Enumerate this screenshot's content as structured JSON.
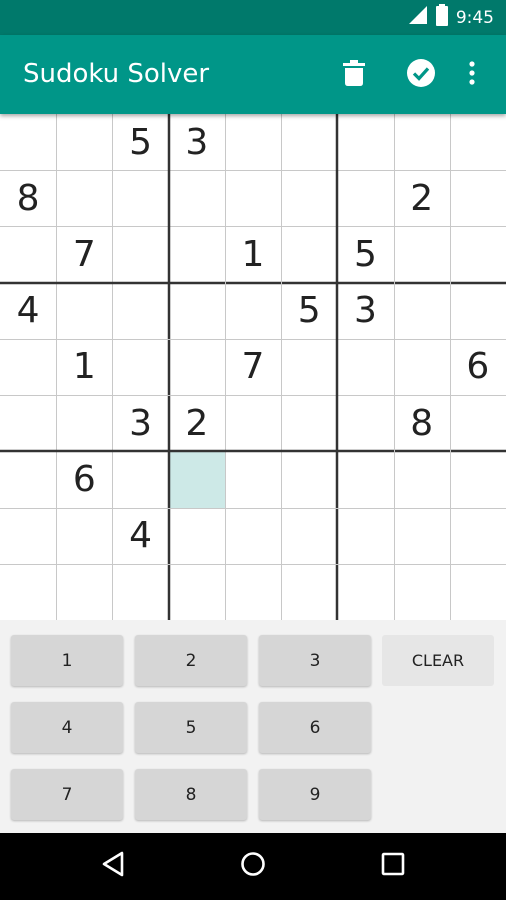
{
  "status_bar": {
    "time": "9:45",
    "icons": [
      "signal-icon",
      "battery-icon"
    ]
  },
  "app_bar": {
    "title": "Sudoku Solver",
    "actions": [
      "delete-icon",
      "check-circle-icon",
      "more-vert-icon"
    ]
  },
  "board": {
    "selected": [
      6,
      3
    ],
    "colors": {
      "selected": "#cde9e7",
      "grid_thin": "#c8c8c8",
      "grid_thick": "#333333"
    },
    "rows": [
      [
        "",
        "",
        "5",
        "3",
        "",
        "",
        "",
        "",
        ""
      ],
      [
        "8",
        "",
        "",
        "",
        "",
        "",
        "",
        "2",
        ""
      ],
      [
        "",
        "7",
        "",
        "",
        "1",
        "",
        "5",
        "",
        ""
      ],
      [
        "4",
        "",
        "",
        "",
        "",
        "5",
        "3",
        "",
        ""
      ],
      [
        "",
        "1",
        "",
        "",
        "7",
        "",
        "",
        "",
        "6"
      ],
      [
        "",
        "",
        "3",
        "2",
        "",
        "",
        "",
        "8",
        ""
      ],
      [
        "",
        "6",
        "",
        "",
        "",
        "",
        "",
        "",
        ""
      ],
      [
        "",
        "",
        "4",
        "",
        "",
        "",
        "",
        "",
        ""
      ],
      [
        "",
        "",
        "",
        "",
        "",
        "",
        "",
        "",
        ""
      ]
    ]
  },
  "keypad": {
    "keys": [
      "1",
      "2",
      "3",
      "4",
      "5",
      "6",
      "7",
      "8",
      "9"
    ],
    "clear_label": "CLEAR"
  },
  "nav_bar": {
    "icons": [
      "back-icon",
      "home-icon",
      "recents-icon"
    ]
  },
  "colors": {
    "status_bar": "#00796b",
    "app_bar": "#009688",
    "key": "#d6d6d6",
    "nav_bar": "#000000"
  }
}
